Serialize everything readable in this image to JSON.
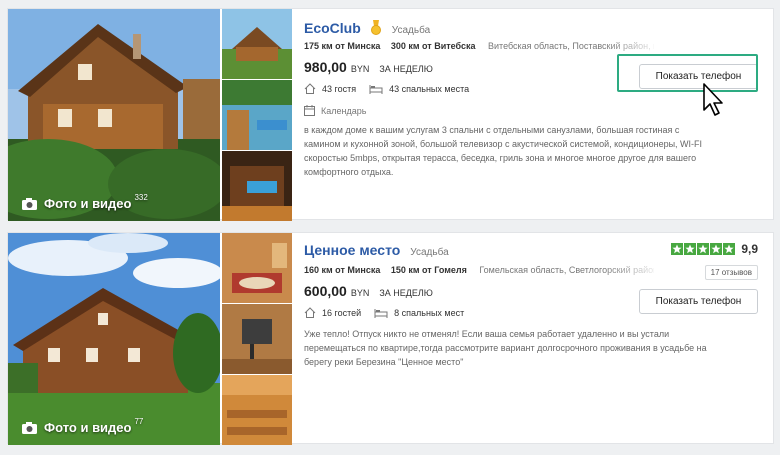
{
  "listings": [
    {
      "title": "EcoClub",
      "type": "Усадьба",
      "distance1": "175 км от Минска",
      "distance2": "300 км от Витебска",
      "region": "Витебская область, Поставский район, г",
      "price": "980,00",
      "currency": "BYN",
      "period": "ЗА НЕДЕЛЮ",
      "guests": "43 гостя",
      "beds": "43 спальных места",
      "calendar": "Календарь",
      "description": "в каждом доме к вашим услугам 3 спальни с отдельными санузлами, большая гостиная с камином и кухонной зоной, большой телевизор с акустической системой, кондиционеры, WI-FI скоростью 5mbps, открытая терасса, беседка, гриль зона и многое многое другое для вашего комфортного отдыха.",
      "photo_label": "Фото и видео",
      "photo_count": "332",
      "phone_button": "Показать телефон"
    },
    {
      "title": "Ценное место",
      "type": "Усадьба",
      "rating": "9,9",
      "reviews": "17 отзывов",
      "distance1": "160 км от Минска",
      "distance2": "150 км от Гомеля",
      "region": "Гомельская область, Светлогорский район",
      "price": "600,00",
      "currency": "BYN",
      "period": "ЗА НЕДЕЛЮ",
      "guests": "16 гостей",
      "beds": "8 спальных мест",
      "description": "Уже тепло! Отпуск никто не отменял! Если ваша семья работает удаленно и вы устали перемещаться по квартире,тогда рассмотрите вариант долгосрочного проживания в усадьбе на берегу реки Березина \"Ценное место\"",
      "photo_label": "Фото и видео",
      "photo_count": "77",
      "phone_button": "Показать телефон"
    }
  ],
  "colors": {
    "title": "#2d5ba6",
    "highlight": "#2dab82",
    "star": "#48a841"
  },
  "icons": [
    "camera-icon",
    "medal-icon",
    "house-icon",
    "bed-icon",
    "calendar-icon",
    "star-icon",
    "cursor-icon"
  ]
}
